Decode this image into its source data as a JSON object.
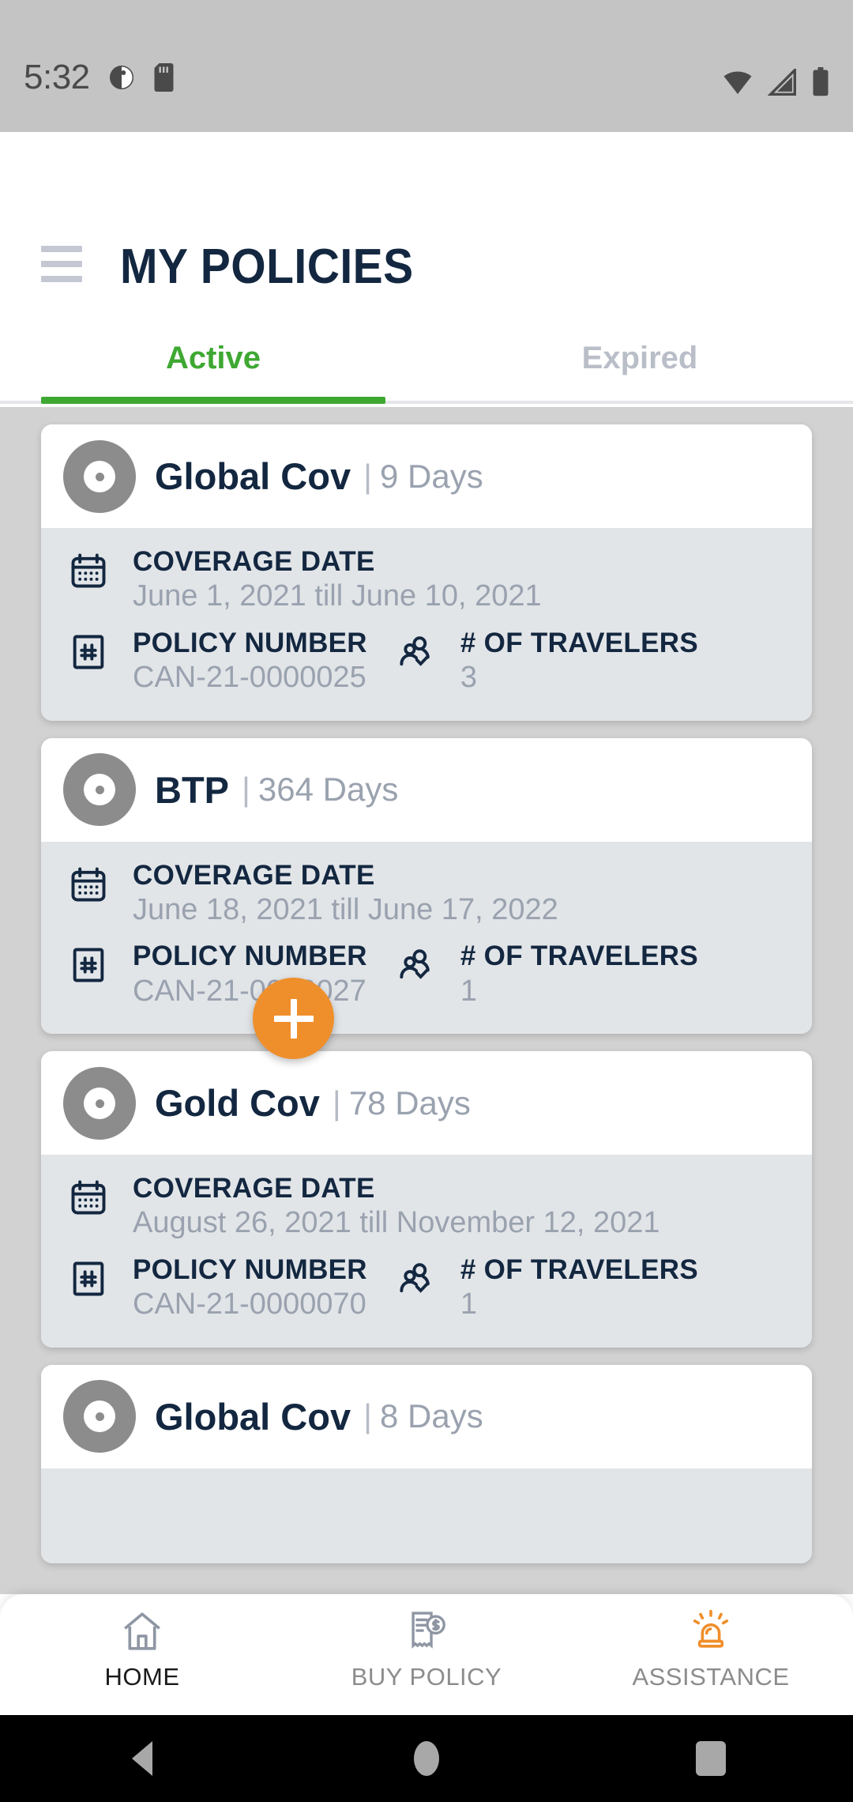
{
  "status_bar": {
    "time": "5:32",
    "left_icons": [
      "alarm-contrast-icon",
      "sd-card-icon"
    ],
    "right_icons": [
      "wifi-icon",
      "signal-icon",
      "battery-icon"
    ]
  },
  "header": {
    "menu_icon": "hamburger-icon",
    "title": "MY POLICIES"
  },
  "tabs": {
    "items": [
      {
        "label": "Active",
        "selected": true
      },
      {
        "label": "Expired",
        "selected": false
      }
    ],
    "active_color": "#3ea832",
    "inactive_color": "#b9bec8"
  },
  "labels": {
    "coverage_date": "COVERAGE DATE",
    "policy_number": "POLICY NUMBER",
    "travelers": "# OF TRAVELERS",
    "separator": "|"
  },
  "policies": [
    {
      "name": "Global Cov",
      "days": "9 Days",
      "coverage_date": "June 1, 2021 till June 10, 2021",
      "policy_number": "CAN-21-0000025",
      "travelers": "3"
    },
    {
      "name": "BTP",
      "days": "364 Days",
      "coverage_date": "June 18, 2021 till June 17, 2022",
      "policy_number": "CAN-21-0000027",
      "travelers": "1"
    },
    {
      "name": "Gold Cov",
      "days": "78 Days",
      "coverage_date": "August 26, 2021 till November 12, 2021",
      "policy_number": "CAN-21-0000070",
      "travelers": "1"
    },
    {
      "name": "Global Cov",
      "days": "8 Days",
      "coverage_date": "",
      "policy_number": "",
      "travelers": ""
    }
  ],
  "fab": {
    "icon": "plus-icon",
    "color": "#ef8f2c"
  },
  "bottom_nav": {
    "items": [
      {
        "label": "HOME",
        "icon": "home-icon",
        "selected": true
      },
      {
        "label": "BUY POLICY",
        "icon": "invoice-dollar-icon",
        "selected": false
      },
      {
        "label": "ASSISTANCE",
        "icon": "siren-icon",
        "selected": false
      }
    ]
  },
  "system_nav": {
    "back": "back-triangle-icon",
    "home": "home-circle-icon",
    "recents": "recents-square-icon"
  },
  "colors": {
    "navy": "#132740",
    "green": "#3ea832",
    "orange": "#ef8f2c",
    "gray_text": "#9aa2af",
    "card_body": "#e2e5e8"
  }
}
